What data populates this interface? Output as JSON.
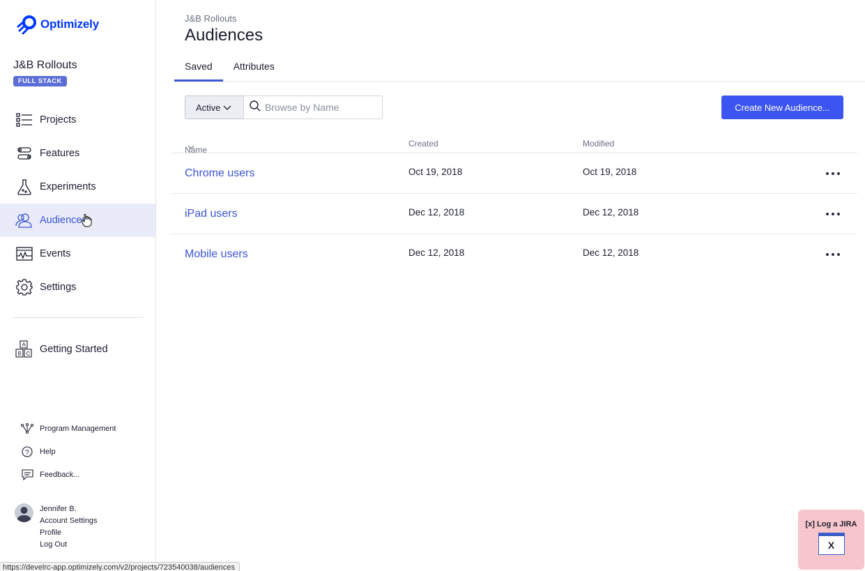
{
  "brand": {
    "name": "Optimizely",
    "color": "#0037ff"
  },
  "project": {
    "name": "J&B Rollouts",
    "badge": "FULL STACK"
  },
  "nav": {
    "items": [
      {
        "label": "Projects",
        "icon": "projects-icon"
      },
      {
        "label": "Features",
        "icon": "features-icon"
      },
      {
        "label": "Experiments",
        "icon": "flask-icon"
      },
      {
        "label": "Audiences",
        "icon": "audiences-icon",
        "active": true
      },
      {
        "label": "Events",
        "icon": "events-icon"
      },
      {
        "label": "Settings",
        "icon": "gear-icon"
      }
    ],
    "getting_started": "Getting Started"
  },
  "secondary_links": {
    "program_management": "Program Management",
    "help": "Help",
    "feedback": "Feedback..."
  },
  "user": {
    "name": "Jennifer B.",
    "account_settings": "Account Settings",
    "profile": "Profile",
    "logout": "Log Out"
  },
  "status_url": "https://develrc-app.optimizely.com/v2/projects/723540038/audiences",
  "page": {
    "breadcrumb": "J&B Rollouts",
    "title": "Audiences",
    "tabs": [
      {
        "label": "Saved",
        "active": true
      },
      {
        "label": "Attributes",
        "active": false
      }
    ]
  },
  "toolbar": {
    "filter": "Active",
    "search_placeholder": "Browse by Name",
    "create_button": "Create New Audience..."
  },
  "table": {
    "columns": {
      "name": "Name",
      "created": "Created",
      "modified": "Modified"
    },
    "rows": [
      {
        "name": "Chrome users",
        "created": "Oct 19, 2018",
        "modified": "Oct 19, 2018"
      },
      {
        "name": "iPad users",
        "created": "Dec 12, 2018",
        "modified": "Dec 12, 2018"
      },
      {
        "name": "Mobile users",
        "created": "Dec 12, 2018",
        "modified": "Dec 12, 2018"
      }
    ]
  },
  "jira_widget": {
    "label": "[x] Log a JIRA",
    "icon_glyph": "X"
  },
  "colors": {
    "accent": "#3c55d3",
    "button": "#3c55f0",
    "active_nav_bg": "#e9ebf8",
    "badge": "#5b6ed6"
  }
}
